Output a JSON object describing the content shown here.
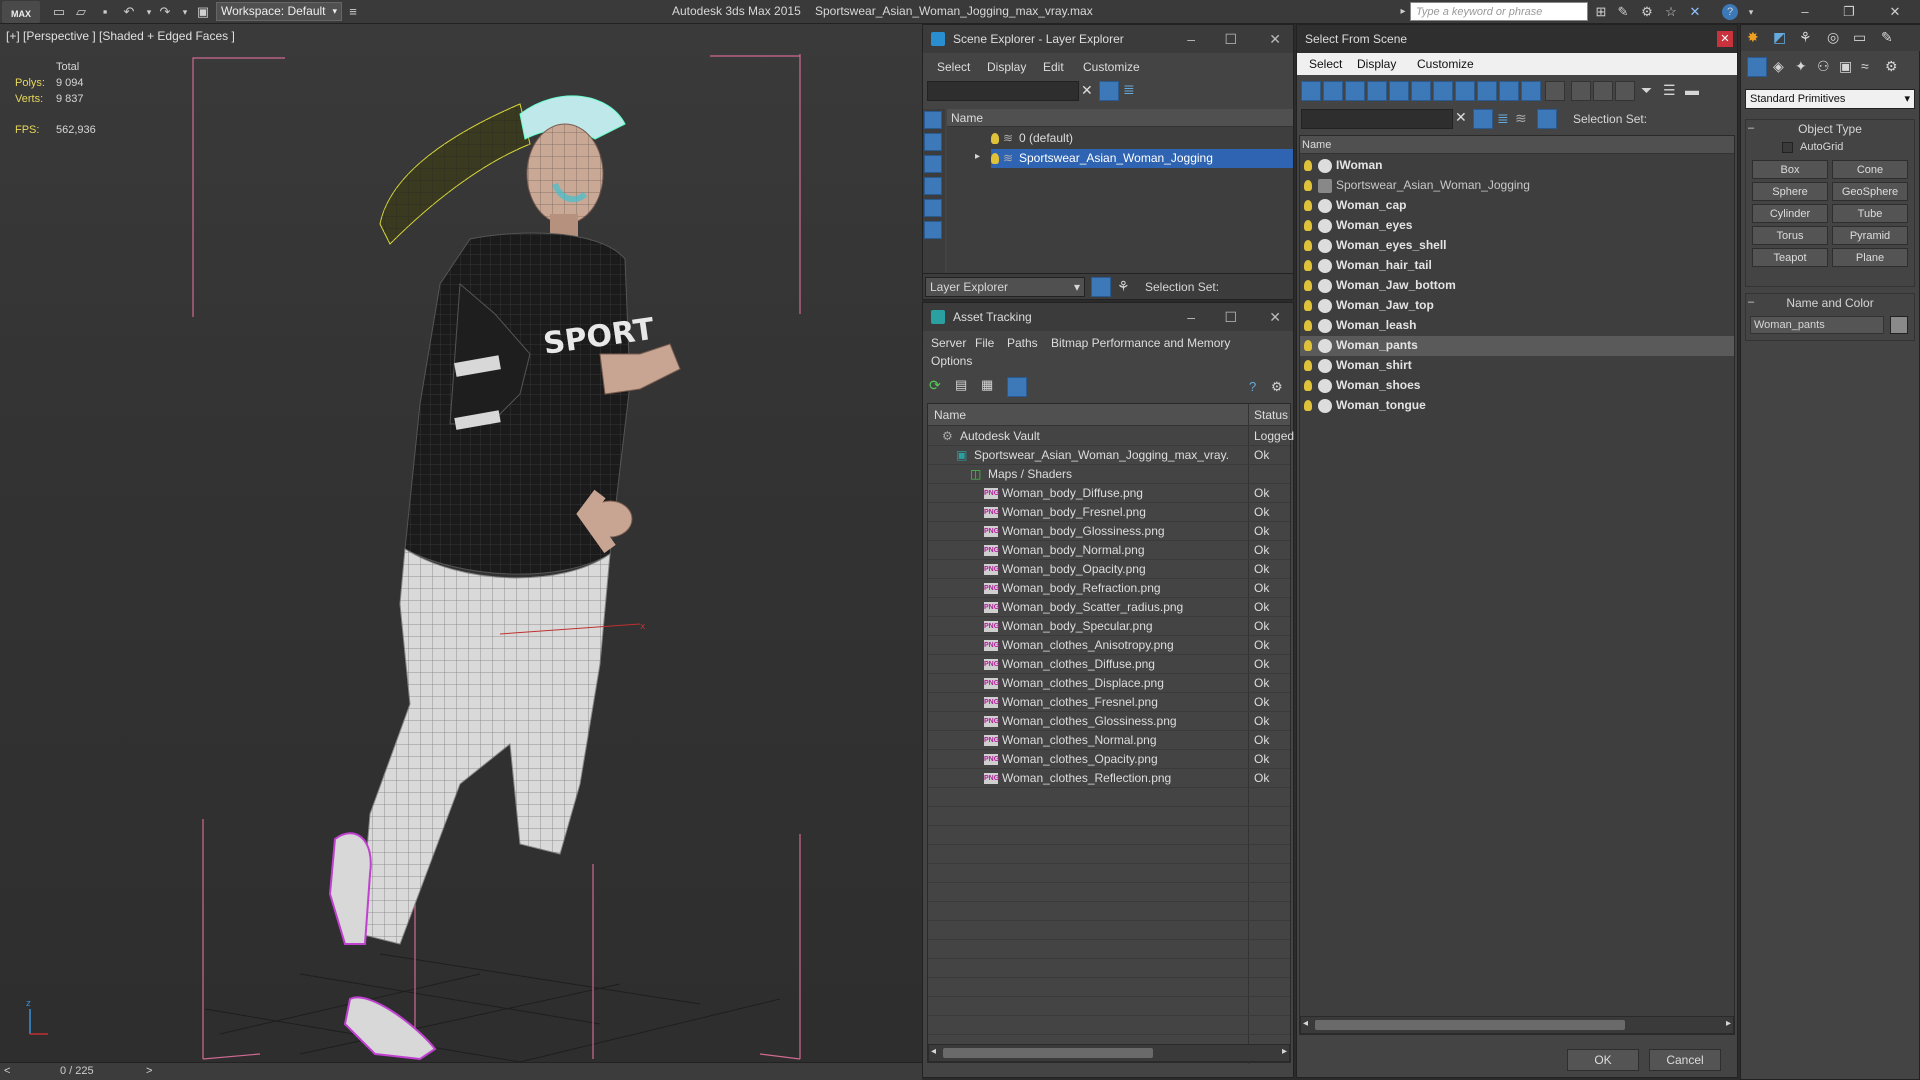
{
  "app": {
    "logo": "MAX",
    "workspace": "Workspace: Default",
    "title_app": "Autodesk 3ds Max  2015",
    "title_file": "Sportswear_Asian_Woman_Jogging_max_vray.max",
    "search_placeholder": "Type a keyword or phrase"
  },
  "viewport": {
    "label": "[+] [Perspective ] [Shaded + Edged Faces ]",
    "stats": {
      "total_label": "Total",
      "polys_label": "Polys:",
      "polys": "9 094",
      "verts_label": "Verts:",
      "verts": "9 837",
      "fps_label": "FPS:",
      "fps": "562,936"
    },
    "shirt_text": "SPORT",
    "axis_z": "z",
    "axis_x": "x"
  },
  "timeline": {
    "value": "0 / 225",
    "prev": "<",
    "next": ">"
  },
  "scene_explorer": {
    "title": "Scene Explorer - Layer Explorer",
    "menus": [
      "Select",
      "Display",
      "Edit",
      "Customize"
    ],
    "col_name": "Name",
    "rows": [
      "0 (default)",
      "Sportswear_Asian_Woman_Jogging"
    ],
    "footer_label": "Layer Explorer",
    "selection_set": "Selection Set:"
  },
  "asset_tracking": {
    "title": "Asset Tracking",
    "menus": [
      "Server",
      "File",
      "Paths",
      "Bitmap Performance and Memory",
      "Options"
    ],
    "col_name": "Name",
    "col_status": "Status",
    "rows": [
      {
        "name": "Autodesk Vault",
        "status": "Logged",
        "level": 0,
        "icon": "vault"
      },
      {
        "name": "Sportswear_Asian_Woman_Jogging_max_vray....",
        "status": "Ok",
        "level": 1,
        "icon": "max"
      },
      {
        "name": "Maps / Shaders",
        "status": "",
        "level": 2,
        "icon": "maps"
      },
      {
        "name": "Woman_body_Diffuse.png",
        "status": "Ok",
        "level": 3,
        "icon": "png"
      },
      {
        "name": "Woman_body_Fresnel.png",
        "status": "Ok",
        "level": 3,
        "icon": "png"
      },
      {
        "name": "Woman_body_Glossiness.png",
        "status": "Ok",
        "level": 3,
        "icon": "png"
      },
      {
        "name": "Woman_body_Normal.png",
        "status": "Ok",
        "level": 3,
        "icon": "png"
      },
      {
        "name": "Woman_body_Opacity.png",
        "status": "Ok",
        "level": 3,
        "icon": "png"
      },
      {
        "name": "Woman_body_Refraction.png",
        "status": "Ok",
        "level": 3,
        "icon": "png"
      },
      {
        "name": "Woman_body_Scatter_radius.png",
        "status": "Ok",
        "level": 3,
        "icon": "png"
      },
      {
        "name": "Woman_body_Specular.png",
        "status": "Ok",
        "level": 3,
        "icon": "png"
      },
      {
        "name": "Woman_clothes_Anisotropy.png",
        "status": "Ok",
        "level": 3,
        "icon": "png"
      },
      {
        "name": "Woman_clothes_Diffuse.png",
        "status": "Ok",
        "level": 3,
        "icon": "png"
      },
      {
        "name": "Woman_clothes_Displace.png",
        "status": "Ok",
        "level": 3,
        "icon": "png"
      },
      {
        "name": "Woman_clothes_Fresnel.png",
        "status": "Ok",
        "level": 3,
        "icon": "png"
      },
      {
        "name": "Woman_clothes_Glossiness.png",
        "status": "Ok",
        "level": 3,
        "icon": "png"
      },
      {
        "name": "Woman_clothes_Normal.png",
        "status": "Ok",
        "level": 3,
        "icon": "png"
      },
      {
        "name": "Woman_clothes_Opacity.png",
        "status": "Ok",
        "level": 3,
        "icon": "png"
      },
      {
        "name": "Woman_clothes_Reflection.png",
        "status": "Ok",
        "level": 3,
        "icon": "png"
      }
    ],
    "png_label": "PNG"
  },
  "select_from_scene": {
    "title": "Select From Scene",
    "menus": [
      "Select",
      "Display",
      "Customize"
    ],
    "selection_set": "Selection Set:",
    "col_name": "Name",
    "items": [
      {
        "name": "IWoman",
        "bold": true,
        "selected": false
      },
      {
        "name": "Sportswear_Asian_Woman_Jogging",
        "bold": false,
        "selected": false
      },
      {
        "name": "Woman_cap",
        "bold": true,
        "selected": false
      },
      {
        "name": "Woman_eyes",
        "bold": true,
        "selected": false
      },
      {
        "name": "Woman_eyes_shell",
        "bold": true,
        "selected": false
      },
      {
        "name": "Woman_hair_tail",
        "bold": true,
        "selected": false
      },
      {
        "name": "Woman_Jaw_bottom",
        "bold": true,
        "selected": false
      },
      {
        "name": "Woman_Jaw_top",
        "bold": true,
        "selected": false
      },
      {
        "name": "Woman_leash",
        "bold": true,
        "selected": false
      },
      {
        "name": "Woman_pants",
        "bold": true,
        "selected": true
      },
      {
        "name": "Woman_shirt",
        "bold": true,
        "selected": false
      },
      {
        "name": "Woman_shoes",
        "bold": true,
        "selected": false
      },
      {
        "name": "Woman_tongue",
        "bold": true,
        "selected": false
      }
    ],
    "ok": "OK",
    "cancel": "Cancel"
  },
  "command_panel": {
    "dropdown": "Standard Primitives",
    "object_type": "Object Type",
    "autogrid": "AutoGrid",
    "buttons": [
      "Box",
      "Cone",
      "Sphere",
      "GeoSphere",
      "Cylinder",
      "Tube",
      "Torus",
      "Pyramid",
      "Teapot",
      "Plane"
    ],
    "name_and_color": "Name and Color",
    "name_value": "Woman_pants",
    "color": "#8a8a8a"
  },
  "colors": {
    "accent": "#3d78b8",
    "selection": "#2f64b3",
    "wire_pink": "#e0709a",
    "shoe_purple": "#c040d0"
  }
}
